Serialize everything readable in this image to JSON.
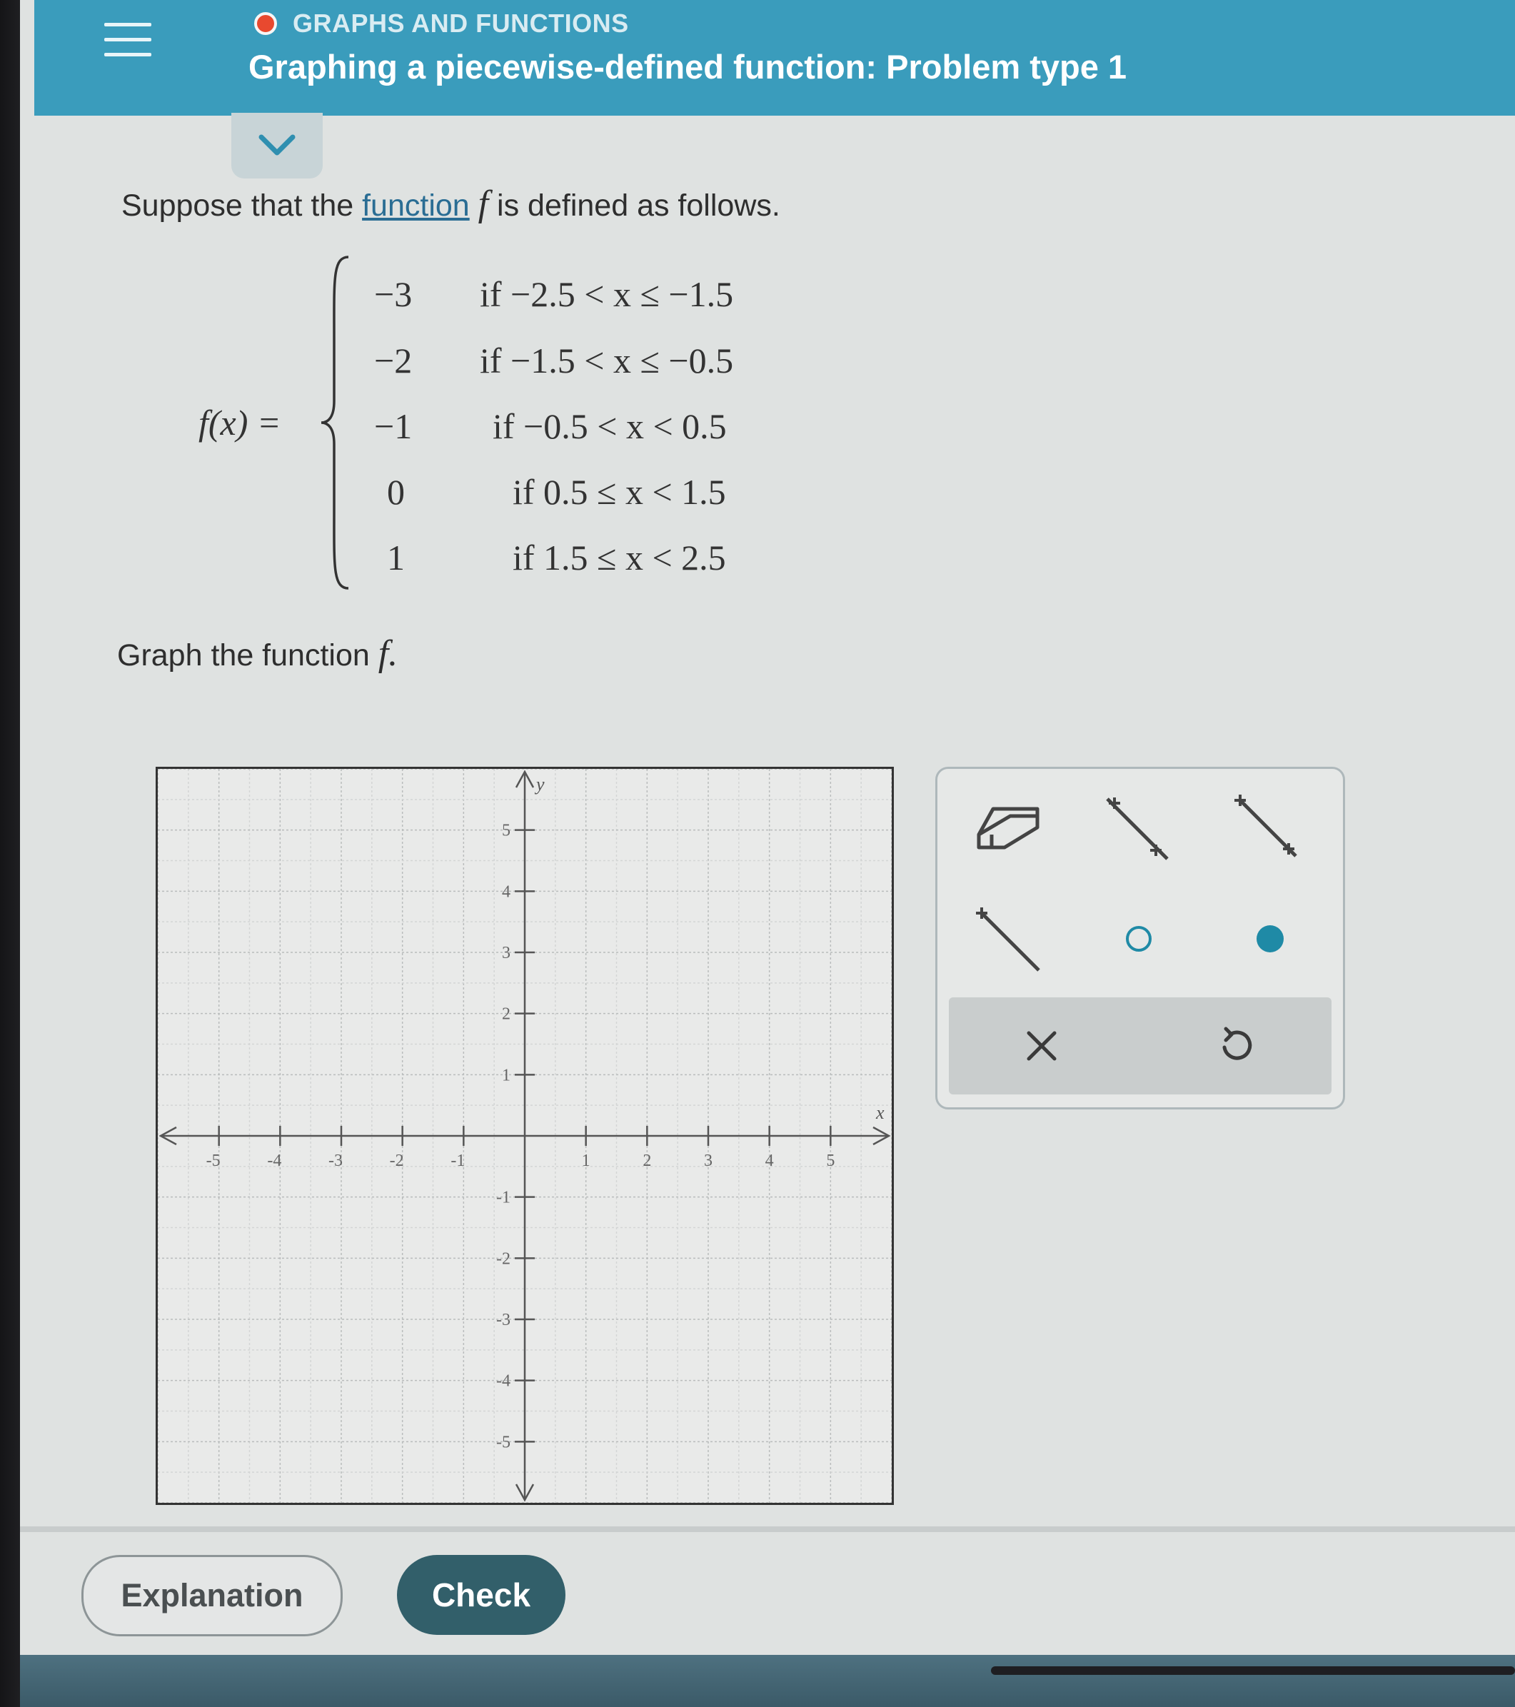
{
  "header": {
    "topic": "GRAPHS AND FUNCTIONS",
    "title": "Graphing a piecewise-defined function: Problem type 1",
    "menu_icon": "hamburger-menu-icon",
    "collapse_icon": "chevron-down-icon",
    "topic_color": "#e8492f",
    "bar_color": "#3a9cbc"
  },
  "question": {
    "intro_before": "Suppose that the ",
    "intro_link": "function",
    "intro_var": "f",
    "intro_after": " is defined as follows.",
    "lhs": "f(x) =",
    "pieces": [
      {
        "value": "−3",
        "condition": "if −2.5 < x ≤ −1.5"
      },
      {
        "value": "−2",
        "condition": "if −1.5 < x ≤ −0.5"
      },
      {
        "value": "−1",
        "condition": "if −0.5 < x < 0.5"
      },
      {
        "value": "0",
        "condition": "if 0.5 ≤ x < 1.5"
      },
      {
        "value": "1",
        "condition": "if 1.5 ≤ x < 2.5"
      }
    ],
    "prompt_text": "Graph the function ",
    "prompt_var": "f."
  },
  "graph": {
    "x_axis_label": "x",
    "y_axis_label": "y",
    "x_range": [
      -6,
      6
    ],
    "y_range": [
      -6,
      6
    ],
    "x_tick_labels": [
      "-5",
      "-4",
      "-3",
      "-2",
      "-1",
      "1",
      "2",
      "3",
      "4",
      "5"
    ],
    "y_tick_labels": [
      "5",
      "4",
      "3",
      "2",
      "1",
      "-1",
      "-2",
      "-3",
      "-4",
      "-5"
    ]
  },
  "tools": {
    "eraser": "eraser-icon",
    "line": "line-tool-icon",
    "ray": "ray-tool-icon",
    "segment": "segment-tool-icon",
    "open_point": "open-point-icon",
    "closed_point": "closed-point-icon",
    "clear": "clear-x-icon",
    "undo": "undo-icon",
    "accent_color": "#1f8aa6"
  },
  "buttons": {
    "explanation": "Explanation",
    "check": "Check"
  }
}
